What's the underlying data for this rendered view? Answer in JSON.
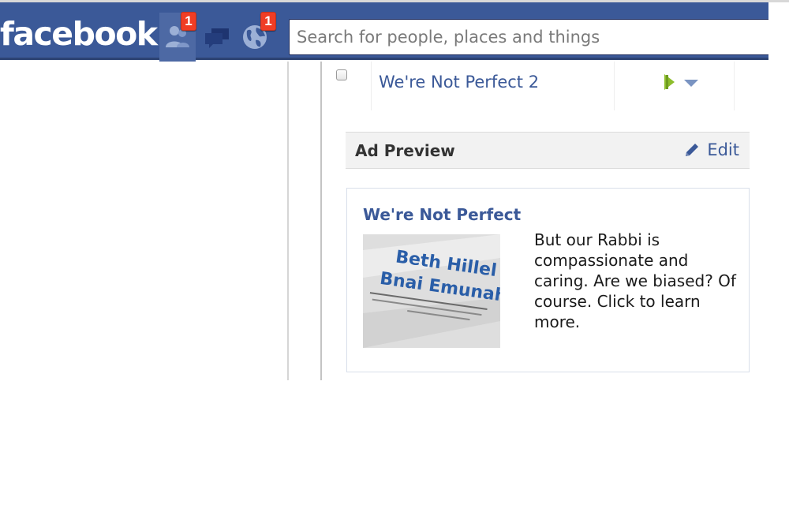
{
  "header": {
    "logo_text": "facebook",
    "brand_color": "#3b5998",
    "jewels": [
      {
        "name": "friend-requests",
        "icon": "friends-icon",
        "badge": "1"
      },
      {
        "name": "messages",
        "icon": "messages-icon",
        "badge": ""
      },
      {
        "name": "notifications",
        "icon": "globe-icon",
        "badge": "1"
      }
    ],
    "search_placeholder": "Search for people, places and things"
  },
  "ad_row": {
    "title": "We're Not Perfect 2",
    "status_icon": "play-icon",
    "menu_icon": "chevron-down-icon"
  },
  "ad_preview": {
    "heading": "Ad Preview",
    "edit_label": "Edit",
    "edit_icon": "pencil-icon"
  },
  "ad_card": {
    "title": "We're Not Perfect",
    "image_text": {
      "line1": "Beth Hillel",
      "line2": "Bnai Emunah"
    },
    "body": "But our Rabbi is compassionate and caring. Are we biased? Of course. Click to learn more."
  }
}
